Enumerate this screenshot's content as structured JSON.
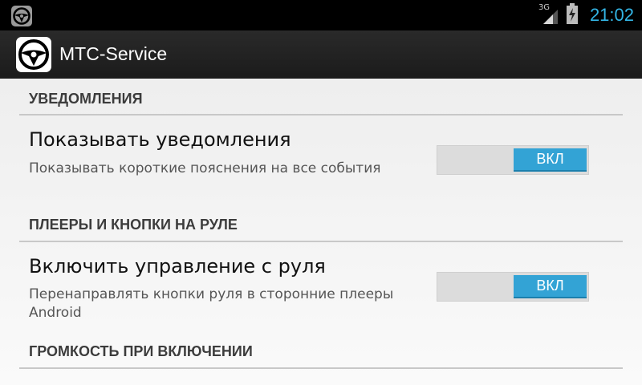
{
  "status_bar": {
    "network_type": "3G",
    "time": "21:02",
    "time_color": "#33b5e5",
    "icons": [
      "steering-wheel-icon",
      "signal-icon",
      "battery-charging-icon"
    ]
  },
  "action_bar": {
    "title": "MTC-Service",
    "icon": "steering-wheel-icon"
  },
  "sections": [
    {
      "header": "УВЕДОМЛЕНИЯ",
      "pref": {
        "title": "Показывать уведомления",
        "summary": "Показывать короткие пояснения на все события",
        "switch_label": "ВКЛ",
        "checked": true
      }
    },
    {
      "header": "ПЛЕЕРЫ И КНОПКИ НА РУЛЕ",
      "pref": {
        "title": "Включить управление с руля",
        "summary": "Перенаправлять кнопки руля в сторонние плееры Android",
        "switch_label": "ВКЛ",
        "checked": true
      }
    },
    {
      "header": "ГРОМКОСТЬ ПРИ ВКЛЮЧЕНИИ"
    }
  ],
  "colors": {
    "accent": "#33a3d5",
    "action_bar": "#222222",
    "status_bar": "#000000"
  }
}
